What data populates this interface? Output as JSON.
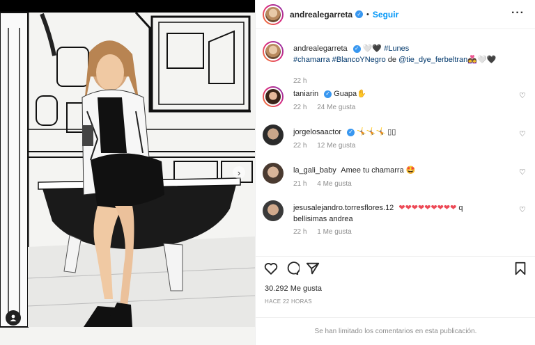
{
  "header": {
    "username": "andrealegarreta",
    "separator": "•",
    "follow_label": "Seguir",
    "more_label": "···"
  },
  "caption": {
    "username": "andrealegarreta",
    "hearts": "🤍🖤",
    "text_tags_1": "#Lunes",
    "text_tags_2": "#chamarra #BlancoYNegro",
    "text_de": "de",
    "mention": "@tie_dye_ferbeltran",
    "trail_emoji": "👩‍❤️‍👩🤍🖤",
    "time": "22 h"
  },
  "comments": [
    {
      "username": "taniarin",
      "verified": true,
      "text": "Guapa✋",
      "time": "22 h",
      "likes": "24 Me gusta"
    },
    {
      "username": "jorgelosaactor",
      "verified": true,
      "text": "🤸🤸🤸 ▯▯",
      "time": "22 h",
      "likes": "12 Me gusta"
    },
    {
      "username": "la_gali_baby",
      "verified": false,
      "text": "Amee tu chamarra 🤩",
      "time": "21 h",
      "likes": "4 Me gusta"
    },
    {
      "username": "jesusalejandro.torresflores.12",
      "verified": false,
      "text_hearts": "❤❤❤❤❤❤❤❤❤",
      "text_q": "q",
      "text_2": "bellisimas andrea",
      "time": "22 h",
      "likes": "1 Me gusta"
    }
  ],
  "actions": {
    "likes_count": "30.292",
    "likes_label": "Me gusta",
    "timestamp": "HACE 22 HORAS"
  },
  "footer": {
    "limited_text": "Se han limitado los comentarios en esta publicación."
  },
  "icons": {
    "like": "heart-icon",
    "comment": "comment-icon",
    "share": "share-icon",
    "save": "bookmark-icon",
    "tag": "user-tag-icon"
  },
  "colors": {
    "link": "#0095f6",
    "verified": "#3897f0",
    "hashtag": "#00376b",
    "muted": "#8e8e8e"
  }
}
